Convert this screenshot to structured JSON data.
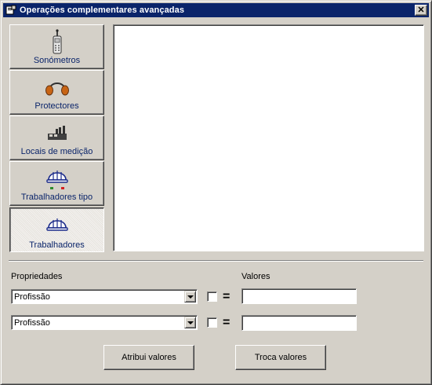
{
  "window": {
    "title": "Operações complementares avançadas",
    "title_bar_color": "#0a246a"
  },
  "nav": {
    "items": [
      {
        "label": "Sonómetros",
        "icon": "sound-level-meter-icon"
      },
      {
        "label": "Protectores",
        "icon": "ear-protector-icon"
      },
      {
        "label": "Locais de medição",
        "icon": "factory-icon"
      },
      {
        "label": "Trabalhadores tipo",
        "icon": "hard-hat-flag-icon"
      },
      {
        "label": "Trabalhadores",
        "icon": "hard-hat-icon",
        "selected": true
      }
    ]
  },
  "form": {
    "properties_label": "Propriedades",
    "values_label": "Valores",
    "rows": [
      {
        "property": "Profissão",
        "checked": false,
        "equals": "=",
        "value": ""
      },
      {
        "property": "Profissão",
        "checked": false,
        "equals": "=",
        "value": ""
      }
    ]
  },
  "buttons": {
    "assign": "Atribui valores",
    "swap": "Troca valores"
  }
}
